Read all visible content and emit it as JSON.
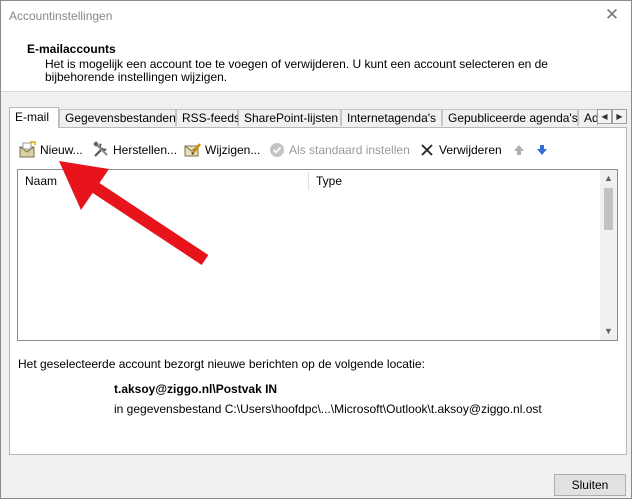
{
  "window": {
    "title": "Accountinstellingen",
    "close_glyph": "✕"
  },
  "header": {
    "title": "E-mailaccounts",
    "description": "Het is mogelijk een account toe te voegen of verwijderen. U kunt een account selecteren en de bijbehorende instellingen wijzigen."
  },
  "tabs": [
    {
      "label": "E-mail",
      "active": true
    },
    {
      "label": "Gegevensbestanden"
    },
    {
      "label": "RSS-feeds"
    },
    {
      "label": "SharePoint-lijsten"
    },
    {
      "label": "Internetagenda's"
    },
    {
      "label": "Gepubliceerde agenda's"
    },
    {
      "label": "Ad"
    }
  ],
  "tab_scroll": {
    "left": "◀",
    "right": "▶"
  },
  "toolbar": {
    "new_label": "Nieuw...",
    "repair_label": "Herstellen...",
    "change_label": "Wijzigen...",
    "set_default_label": "Als standaard instellen",
    "remove_label": "Verwijderen",
    "move_up_icon": "arrow-up-icon",
    "move_down_icon": "arrow-down-icon"
  },
  "list": {
    "columns": [
      "Naam",
      "Type"
    ],
    "rows": []
  },
  "scrollbar": {
    "up": "▲",
    "down": "▼"
  },
  "location": {
    "label": "Het geselecteerde account bezorgt nieuwe berichten op de volgende locatie:",
    "mailbox": "t.aksoy@ziggo.nl\\Postvak IN",
    "datafile": "in gegevensbestand C:\\Users\\hoofdpc\\...\\Microsoft\\Outlook\\t.aksoy@ziggo.nl.ost"
  },
  "footer": {
    "close_label": "Sluiten"
  },
  "colors": {
    "annotation_arrow": "#e8141b",
    "move_down_arrow": "#2f6fd6",
    "disabled_text": "#9a9a9a"
  }
}
